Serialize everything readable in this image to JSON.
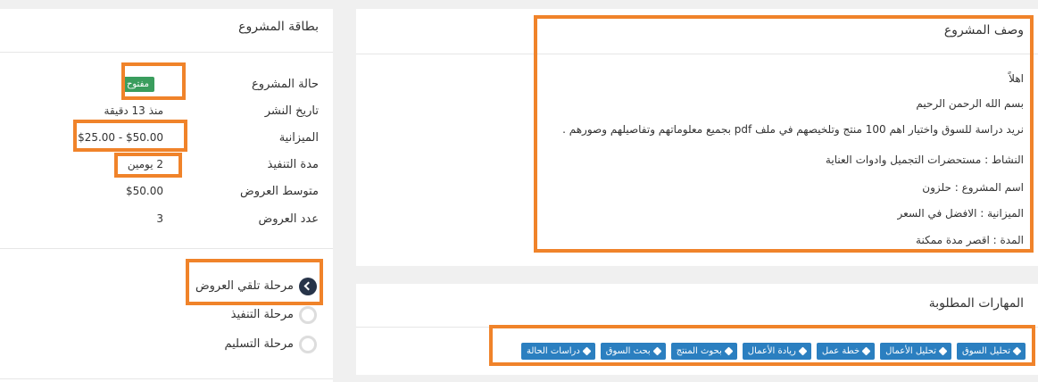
{
  "card": {
    "title": "بطاقة المشروع",
    "rows": [
      {
        "label": "حالة المشروع",
        "value": "مفتوح"
      },
      {
        "label": "تاريخ النشر",
        "value": "منذ 13 دقيقة"
      },
      {
        "label": "الميزانية",
        "value": "$25.00 - $50.00"
      },
      {
        "label": "مدة التنفيذ",
        "value": "2 يومين"
      },
      {
        "label": "متوسط العروض",
        "value": "$50.00"
      },
      {
        "label": "عدد العروض",
        "value": "3"
      }
    ],
    "stages": [
      {
        "label": "مرحلة تلقي العروض",
        "state": "active"
      },
      {
        "label": "مرحلة التنفيذ",
        "state": "idle"
      },
      {
        "label": "مرحلة التسليم",
        "state": "idle"
      }
    ]
  },
  "description": {
    "title": "وصف المشروع",
    "lines": [
      "اهلاً",
      "بسم الله الرحمن الرحيم",
      "نريد دراسة للسوق واختيار اهم 100 منتج وتلخيصهم في ملف pdf بجميع معلوماتهم وتفاصيلهم وصورهم .",
      "النشاط : مستحضرات التجميل وادوات العناية",
      "اسم المشروع : حلزون",
      "الميزانية : الافضل في السعر",
      "المدة : اقصر مدة ممكنة"
    ]
  },
  "skills": {
    "title": "المهارات المطلوبة",
    "tags": [
      "تحليل السوق",
      "تحليل الأعمال",
      "خطة عمل",
      "ريادة الأعمال",
      "بحوث المنتج",
      "بحث السوق",
      "دراسات الحالة"
    ]
  },
  "colors": {
    "highlight": "#f0832a",
    "tag": "#2b7fc0",
    "badge": "#3a9d5d",
    "active_stage": "#273449"
  }
}
